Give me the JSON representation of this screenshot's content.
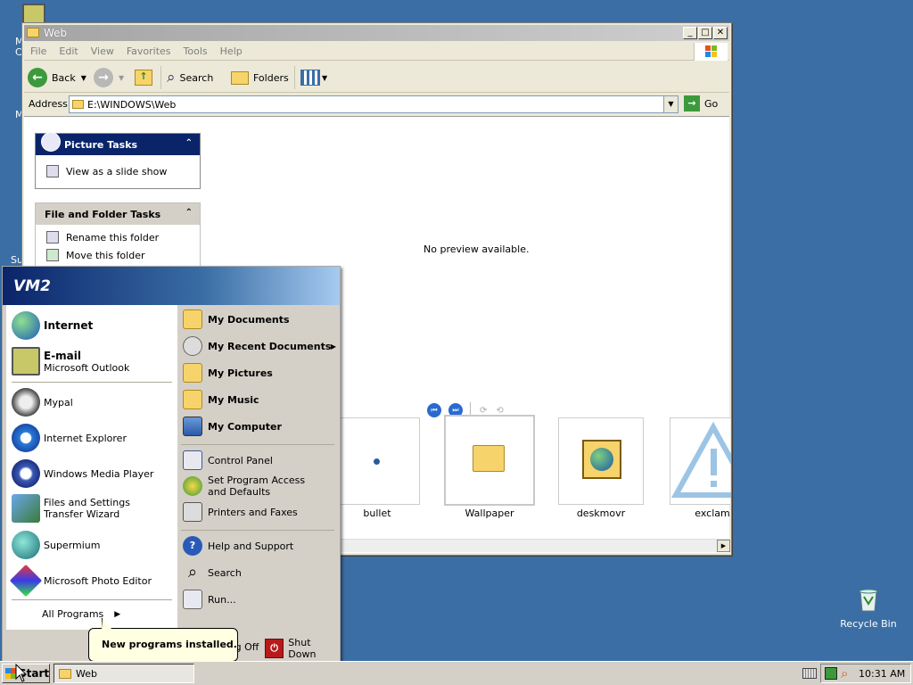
{
  "desktop": {
    "partial_labels": [
      "M",
      "C",
      "M",
      "Su"
    ],
    "recycle_bin_label": "Recycle Bin"
  },
  "window": {
    "title": "Web",
    "menu": [
      "File",
      "Edit",
      "View",
      "Favorites",
      "Tools",
      "Help"
    ],
    "toolbar": {
      "back": "Back",
      "search": "Search",
      "folders": "Folders"
    },
    "address": {
      "label": "Address",
      "value": "E:\\WINDOWS\\Web",
      "go": "Go"
    },
    "picture_tasks": {
      "title": "Picture Tasks",
      "items": [
        "View as a slide show"
      ]
    },
    "file_tasks": {
      "title": "File and Folder Tasks",
      "items": [
        "Rename this folder",
        "Move this folder"
      ]
    },
    "preview_text": "No preview available.",
    "thumbnails": [
      "bullet",
      "Wallpaper",
      "deskmovr",
      "exclam"
    ]
  },
  "start_menu": {
    "user": "VM2",
    "pinned": [
      {
        "title": "Internet",
        "subtitle": ""
      },
      {
        "title": "E-mail",
        "subtitle": "Microsoft Outlook"
      }
    ],
    "recent": [
      "Mypal",
      "Internet Explorer",
      "Windows Media Player",
      "Files and Settings Transfer Wizard",
      "Supermium",
      "Microsoft Photo Editor"
    ],
    "all_programs": "All Programs",
    "right_bold": [
      "My Documents",
      "My Recent Documents",
      "My Pictures",
      "My Music",
      "My Computer"
    ],
    "right_middle": [
      "Control Panel",
      "Set Program Access and Defaults",
      "Printers and Faxes"
    ],
    "right_bottom": [
      "Help and Support",
      "Search",
      "Run..."
    ],
    "log_off": "Log Off",
    "shut_down": "Shut Down"
  },
  "balloon": "New programs installed.",
  "taskbar": {
    "start": "Start",
    "task": "Web",
    "clock": "10:31 AM"
  }
}
